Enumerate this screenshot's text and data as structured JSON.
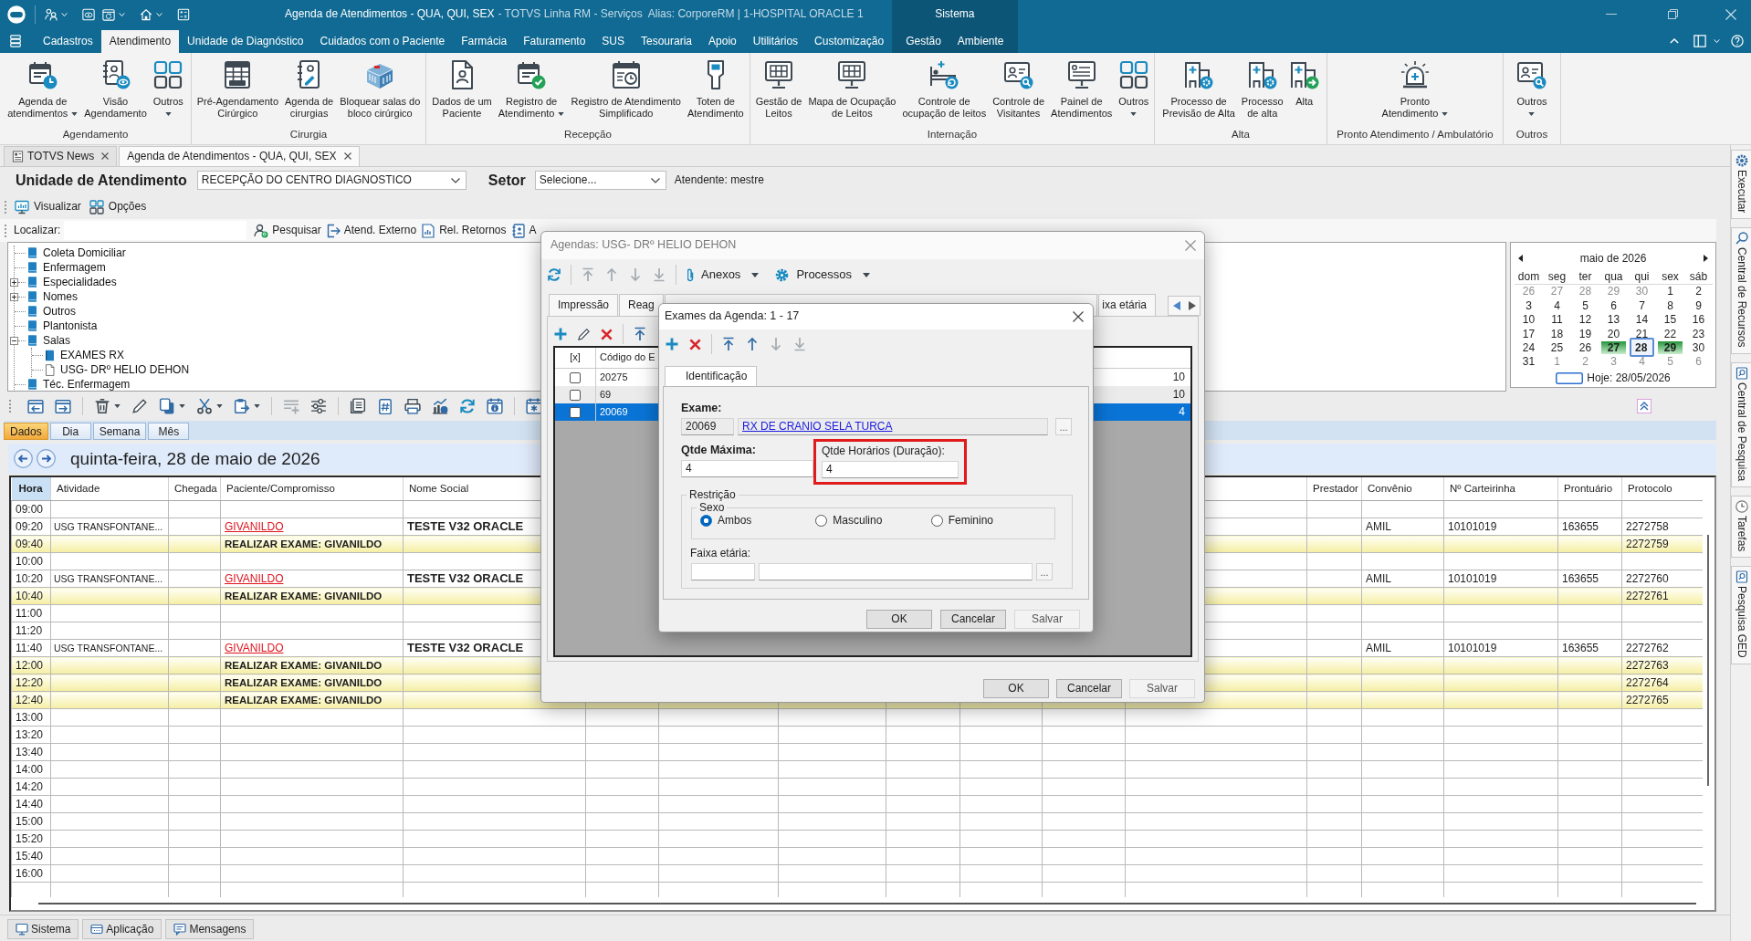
{
  "title_bar": {
    "title": "Agenda de Atendimentos - QUA, QUI, SEX",
    "subtitle": "- TOTVS Linha RM - Serviços  Alias: CorporeRM | 1-HOSPITAL ORACLE 1",
    "context_label": "Sistema"
  },
  "ribbon": {
    "tabs": [
      {
        "label": "Cadastros",
        "selected": false,
        "contextual": false
      },
      {
        "label": "Atendimento",
        "selected": true,
        "contextual": false
      },
      {
        "label": "Unidade de Diagnóstico",
        "selected": false,
        "contextual": false
      },
      {
        "label": "Cuidados com o Paciente",
        "selected": false,
        "contextual": false
      },
      {
        "label": "Farmácia",
        "selected": false,
        "contextual": false
      },
      {
        "label": "Faturamento",
        "selected": false,
        "contextual": false
      },
      {
        "label": "SUS",
        "selected": false,
        "contextual": false
      },
      {
        "label": "Tesouraria",
        "selected": false,
        "contextual": false
      },
      {
        "label": "Apoio",
        "selected": false,
        "contextual": false
      },
      {
        "label": "Utilitários",
        "selected": false,
        "contextual": false
      },
      {
        "label": "Customização",
        "selected": false,
        "contextual": false
      },
      {
        "label": "Gestão",
        "selected": false,
        "contextual": true
      },
      {
        "label": "Ambiente",
        "selected": false,
        "contextual": true
      }
    ],
    "groups": [
      {
        "title": "Agendamento",
        "buttons": [
          {
            "label": "Agenda de\natendimentos",
            "dropdown": true
          },
          {
            "label": "Visão\nAgendamento",
            "dropdown": false
          },
          {
            "label": "Outros",
            "dropdown": true
          }
        ]
      },
      {
        "title": "Cirurgia",
        "buttons": [
          {
            "label": "Pré-Agendamento\nCirúrgico",
            "dropdown": false
          },
          {
            "label": "Agenda de\ncirurgias",
            "dropdown": false
          },
          {
            "label": "Bloquear salas do\nbloco cirúrgico",
            "dropdown": false
          }
        ]
      },
      {
        "title": "Recepção",
        "buttons": [
          {
            "label": "Dados de um\nPaciente",
            "dropdown": false
          },
          {
            "label": "Registro de\nAtendimento",
            "dropdown": true
          },
          {
            "label": "Registro de Atendimento\nSimplificado",
            "dropdown": false
          },
          {
            "label": "Toten de\nAtendimento",
            "dropdown": false
          }
        ]
      },
      {
        "title": "Internação",
        "buttons": [
          {
            "label": "Gestão de\nLeitos",
            "dropdown": false
          },
          {
            "label": "Mapa de Ocupação\nde Leitos",
            "dropdown": false
          },
          {
            "label": "Controle de\nocupação de leitos",
            "dropdown": false
          },
          {
            "label": "Controle de\nVisitantes",
            "dropdown": false
          },
          {
            "label": "Painel de\nAtendimentos",
            "dropdown": false
          },
          {
            "label": "Outros",
            "dropdown": true
          }
        ]
      },
      {
        "title": "Alta",
        "buttons": [
          {
            "label": "Processo de\nPrevisão de Alta",
            "dropdown": false
          },
          {
            "label": "Processo\nde alta",
            "dropdown": false
          },
          {
            "label": "Alta",
            "dropdown": false
          }
        ]
      },
      {
        "title": "Pronto Atendimento / Ambulatório",
        "buttons": [
          {
            "label": "Pronto\nAtendimento",
            "dropdown": true
          }
        ]
      },
      {
        "title": "Outros",
        "buttons": [
          {
            "label": "Outros",
            "dropdown": true
          }
        ]
      }
    ]
  },
  "document_tabs": [
    {
      "label": "TOTVS News",
      "selected": false
    },
    {
      "label": "Agenda de Atendimentos - QUA, QUI, SEX",
      "selected": true
    }
  ],
  "filters": {
    "unit_label": "Unidade de Atendimento",
    "unit_value": "RECEPÇÃO DO CENTRO DIAGNOSTICO",
    "sector_label": "Setor",
    "sector_value": "Selecione...",
    "attendant": "Atendente: mestre"
  },
  "toolbar": [
    {
      "label": "Visualizar"
    },
    {
      "label": "Opções"
    }
  ],
  "search_bar": {
    "label": "Localizar:",
    "actions": [
      {
        "label": "Pesquisar"
      },
      {
        "label": "Atend. Externo"
      },
      {
        "label": "Rel. Retornos"
      },
      {
        "label": "A"
      }
    ]
  },
  "tree": [
    {
      "label": "Coleta Domiciliar"
    },
    {
      "label": "Enfermagem"
    },
    {
      "label": "Especialidades",
      "expanded": false
    },
    {
      "label": "Nomes",
      "expanded": false
    },
    {
      "label": "Outros"
    },
    {
      "label": "Plantonista"
    },
    {
      "label": "Salas",
      "expanded": true,
      "children": [
        {
          "label": "EXAMES RX",
          "kind": "book"
        },
        {
          "label": "USG- DRº HELIO DEHON",
          "kind": "page"
        }
      ]
    },
    {
      "label": "Téc. Enfermagem"
    }
  ],
  "calendar": {
    "month": "maio de 2026",
    "weekdays": [
      "dom",
      "seg",
      "ter",
      "qua",
      "qui",
      "sex",
      "sáb"
    ],
    "weeks": [
      [
        {
          "label": "26",
          "muted": true,
          "marked": false,
          "selected": false
        },
        {
          "label": "27",
          "muted": true,
          "marked": false,
          "selected": false
        },
        {
          "label": "28",
          "muted": true,
          "marked": false,
          "selected": false
        },
        {
          "label": "29",
          "muted": true,
          "marked": false,
          "selected": false
        },
        {
          "label": "30",
          "muted": true,
          "marked": false,
          "selected": false
        },
        {
          "label": "1",
          "muted": false,
          "marked": false,
          "selected": false
        },
        {
          "label": "2",
          "muted": false,
          "marked": false,
          "selected": false
        }
      ],
      [
        {
          "label": "3",
          "muted": false,
          "marked": false,
          "selected": false
        },
        {
          "label": "4",
          "muted": false,
          "marked": false,
          "selected": false
        },
        {
          "label": "5",
          "muted": false,
          "marked": false,
          "selected": false
        },
        {
          "label": "6",
          "muted": false,
          "marked": false,
          "selected": false
        },
        {
          "label": "7",
          "muted": false,
          "marked": false,
          "selected": false
        },
        {
          "label": "8",
          "muted": false,
          "marked": false,
          "selected": false
        },
        {
          "label": "9",
          "muted": false,
          "marked": false,
          "selected": false
        }
      ],
      [
        {
          "label": "10",
          "muted": false,
          "marked": false,
          "selected": false
        },
        {
          "label": "11",
          "muted": false,
          "marked": false,
          "selected": false
        },
        {
          "label": "12",
          "muted": false,
          "marked": false,
          "selected": false
        },
        {
          "label": "13",
          "muted": false,
          "marked": false,
          "selected": false
        },
        {
          "label": "14",
          "muted": false,
          "marked": false,
          "selected": false
        },
        {
          "label": "15",
          "muted": false,
          "marked": false,
          "selected": false
        },
        {
          "label": "16",
          "muted": false,
          "marked": false,
          "selected": false
        }
      ],
      [
        {
          "label": "17",
          "muted": false,
          "marked": false,
          "selected": false
        },
        {
          "label": "18",
          "muted": false,
          "marked": false,
          "selected": false
        },
        {
          "label": "19",
          "muted": false,
          "marked": false,
          "selected": false
        },
        {
          "label": "20",
          "muted": false,
          "marked": false,
          "selected": false
        },
        {
          "label": "21",
          "muted": false,
          "marked": false,
          "selected": false
        },
        {
          "label": "22",
          "muted": false,
          "marked": false,
          "selected": false
        },
        {
          "label": "23",
          "muted": false,
          "marked": false,
          "selected": false
        }
      ],
      [
        {
          "label": "24",
          "muted": false,
          "marked": false,
          "selected": false
        },
        {
          "label": "25",
          "muted": false,
          "marked": false,
          "selected": false
        },
        {
          "label": "26",
          "muted": false,
          "marked": false,
          "selected": false
        },
        {
          "label": "27",
          "muted": false,
          "marked": true,
          "selected": false
        },
        {
          "label": "28",
          "muted": false,
          "marked": false,
          "selected": true
        },
        {
          "label": "29",
          "muted": false,
          "marked": true,
          "selected": false
        },
        {
          "label": "30",
          "muted": false,
          "marked": false,
          "selected": false
        }
      ],
      [
        {
          "label": "31",
          "muted": false,
          "marked": false,
          "selected": false
        },
        {
          "label": "1",
          "muted": true,
          "marked": false,
          "selected": false
        },
        {
          "label": "2",
          "muted": true,
          "marked": false,
          "selected": false
        },
        {
          "label": "3",
          "muted": true,
          "marked": false,
          "selected": false
        },
        {
          "label": "4",
          "muted": true,
          "marked": false,
          "selected": false
        },
        {
          "label": "5",
          "muted": true,
          "marked": false,
          "selected": false
        },
        {
          "label": "6",
          "muted": true,
          "marked": false,
          "selected": false
        }
      ]
    ],
    "today": "Hoje: 28/05/2026"
  },
  "view_tabs": [
    {
      "label": "Dados",
      "selected": true
    },
    {
      "label": "Dia",
      "selected": false
    },
    {
      "label": "Semana",
      "selected": false
    },
    {
      "label": "Mês",
      "selected": false
    }
  ],
  "date_header": {
    "title": "quinta-feira, 28 de maio de 2026"
  },
  "schedule": {
    "columns": [
      {
        "label": "Hora",
        "selected": true
      },
      {
        "label": "Atividade",
        "selected": false
      },
      {
        "label": "Chegada",
        "selected": false
      },
      {
        "label": "Paciente/Compromisso",
        "selected": false
      },
      {
        "label": "Nome Social",
        "selected": false
      },
      {
        "label": "Prestador",
        "selected": false
      },
      {
        "label": "Convênio",
        "selected": false
      },
      {
        "label": "Nº Carteirinha",
        "selected": false
      },
      {
        "label": "Prontuário",
        "selected": false
      },
      {
        "label": "Protocolo",
        "selected": false
      }
    ],
    "rows": [
      {
        "kind": "free",
        "hora": "09:00"
      },
      {
        "kind": "appointment",
        "hora": "09:20",
        "atividade": "USG TRANSFONTANE...",
        "paciente": "GIVANILDO",
        "nome_social": "TESTE V32 ORACLE",
        "convenio": "AMIL",
        "carteirinha": "10101019",
        "prontuario": "163655",
        "protocolo": "2272758"
      },
      {
        "kind": "exam",
        "hora": "09:40",
        "paciente": "REALIZAR EXAME: GIVANILDO",
        "protocolo": "2272759"
      },
      {
        "kind": "free",
        "hora": "10:00"
      },
      {
        "kind": "appointment",
        "hora": "10:20",
        "atividade": "USG TRANSFONTANE...",
        "paciente": "GIVANILDO",
        "nome_social": "TESTE V32 ORACLE",
        "convenio": "AMIL",
        "carteirinha": "10101019",
        "prontuario": "163655",
        "protocolo": "2272760"
      },
      {
        "kind": "exam",
        "hora": "10:40",
        "paciente": "REALIZAR EXAME: GIVANILDO",
        "protocolo": "2272761"
      },
      {
        "kind": "free",
        "hora": "11:00"
      },
      {
        "kind": "free",
        "hora": "11:20"
      },
      {
        "kind": "appointment",
        "hora": "11:40",
        "atividade": "USG TRANSFONTANE...",
        "paciente": "GIVANILDO",
        "nome_social": "TESTE V32 ORACLE",
        "convenio": "AMIL",
        "carteirinha": "10101019",
        "prontuario": "163655",
        "protocolo": "2272762"
      },
      {
        "kind": "exam",
        "hora": "12:00",
        "paciente": "REALIZAR EXAME: GIVANILDO",
        "protocolo": "2272763"
      },
      {
        "kind": "exam",
        "hora": "12:20",
        "paciente": "REALIZAR EXAME: GIVANILDO",
        "protocolo": "2272764"
      },
      {
        "kind": "exam",
        "hora": "12:40",
        "paciente": "REALIZAR EXAME: GIVANILDO",
        "protocolo": "2272765"
      },
      {
        "kind": "free",
        "hora": "13:00"
      },
      {
        "kind": "free",
        "hora": "13:20"
      },
      {
        "kind": "free",
        "hora": "13:40"
      },
      {
        "kind": "free",
        "hora": "14:00"
      },
      {
        "kind": "free",
        "hora": "14:20"
      },
      {
        "kind": "free",
        "hora": "14:40"
      },
      {
        "kind": "free",
        "hora": "15:00"
      },
      {
        "kind": "free",
        "hora": "15:20"
      },
      {
        "kind": "free",
        "hora": "15:40"
      },
      {
        "kind": "free",
        "hora": "16:00"
      }
    ]
  },
  "agendas_dialog": {
    "title": "Agendas: USG- DRº HELIO DEHON",
    "toolbar": [
      {
        "label": "Anexos",
        "dropdown": true
      },
      {
        "label": "Processos",
        "dropdown": true
      }
    ],
    "tabs": [
      {
        "label": "Impressão"
      },
      {
        "label": "Reag"
      },
      {
        "label": "ixa etária"
      }
    ],
    "grid": {
      "columns": [
        "[x]",
        "Código do E"
      ],
      "rows": [
        {
          "code": "20275",
          "quantity": "10",
          "checked": false,
          "selected": false
        },
        {
          "code": "69",
          "quantity": "10",
          "checked": false,
          "selected": false
        },
        {
          "code": "20069",
          "quantity": "4",
          "checked": false,
          "selected": true
        }
      ]
    },
    "buttons": [
      {
        "label": "OK",
        "disabled": false
      },
      {
        "label": "Cancelar",
        "disabled": false
      },
      {
        "label": "Salvar",
        "disabled": true
      }
    ]
  },
  "exam_dialog": {
    "title": "Exames da Agenda: 1 - 17",
    "tabs": [
      {
        "label": "Identificação",
        "selected": true
      }
    ],
    "exam_label": "Exame:",
    "exam_code": "20069",
    "exam_name": "RX DE CRANIO SELA TURCA",
    "exam_lookup": "...",
    "max_label": "Qtde Máxima:",
    "max_value": "4",
    "slots_label": "Qtde Horários (Duração):",
    "slots_value": "4",
    "slots_highlighted": true,
    "restriction_label": "Restrição",
    "sex_label": "Sexo",
    "sex_options": [
      {
        "label": "Ambos",
        "selected": true
      },
      {
        "label": "Masculino",
        "selected": false
      },
      {
        "label": "Feminino",
        "selected": false
      }
    ],
    "age_label": "Faixa etária:",
    "age_lookup": "...",
    "buttons": [
      {
        "label": "OK",
        "disabled": false
      },
      {
        "label": "Cancelar",
        "disabled": false
      },
      {
        "label": "Salvar",
        "disabled": true
      }
    ]
  },
  "side_panel": [
    {
      "label": "Executar"
    },
    {
      "label": "Central de Recursos"
    },
    {
      "label": "Central de Pesquisa"
    },
    {
      "label": "Tarefas"
    },
    {
      "label": "Pesquisa GED"
    }
  ],
  "status_tabs": [
    {
      "label": "Sistema"
    },
    {
      "label": "Aplicação"
    },
    {
      "label": "Mensagens"
    }
  ]
}
